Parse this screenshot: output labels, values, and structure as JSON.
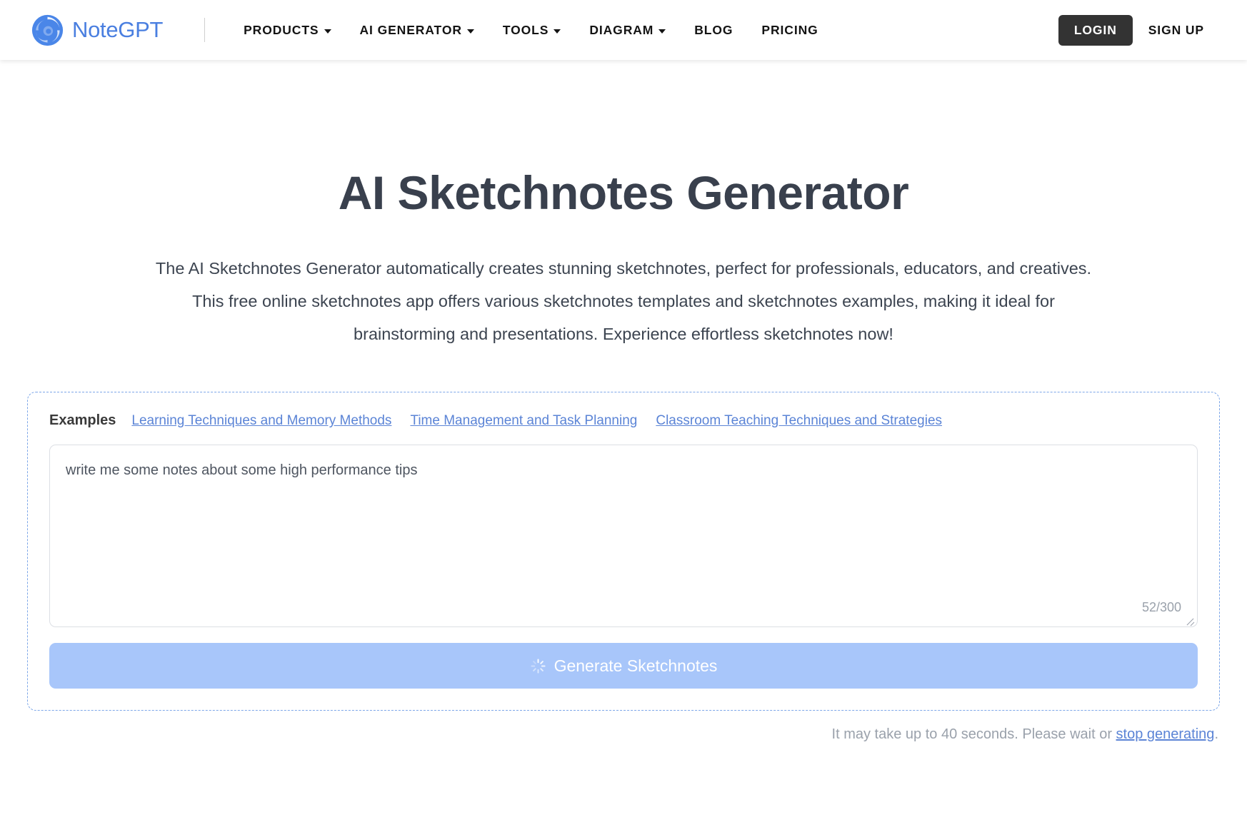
{
  "header": {
    "brand": {
      "name": "NoteGPT",
      "logo_icon": "swirl-logo-icon"
    },
    "nav": [
      {
        "label": "PRODUCTS",
        "has_caret": true
      },
      {
        "label": "AI GENERATOR",
        "has_caret": true
      },
      {
        "label": "TOOLS",
        "has_caret": true
      },
      {
        "label": "DIAGRAM",
        "has_caret": true
      },
      {
        "label": "BLOG",
        "has_caret": false
      },
      {
        "label": "PRICING",
        "has_caret": false
      }
    ],
    "login_label": "LOGIN",
    "signup_label": "SIGN UP"
  },
  "hero": {
    "title": "AI Sketchnotes Generator",
    "description": "The AI Sketchnotes Generator automatically creates stunning sketchnotes, perfect for professionals, educators, and creatives. This free online sketchnotes app offers various sketchnotes templates and sketchnotes examples, making it ideal for brainstorming and presentations. Experience effortless sketchnotes now!"
  },
  "generator": {
    "examples_label": "Examples",
    "examples": [
      "Learning Techniques and Memory Methods",
      "Time Management and Task Planning",
      "Classroom Teaching Techniques and Strategies"
    ],
    "prompt_value": "write me some notes about some high performance tips",
    "prompt_placeholder": "write me some notes about some high performance tips",
    "char_count": "52/300",
    "generate_label": "Generate Sketchnotes",
    "generate_icon": "loading-spinner-icon",
    "status_prefix": "It may take up to 40 seconds. Please wait or ",
    "status_link": "stop generating",
    "status_suffix": "."
  },
  "colors": {
    "brand_blue": "#4a7fe0",
    "link_blue": "#5b84d6",
    "button_blue": "#a8c6fa",
    "dark": "#333333",
    "heading": "#39404d"
  }
}
